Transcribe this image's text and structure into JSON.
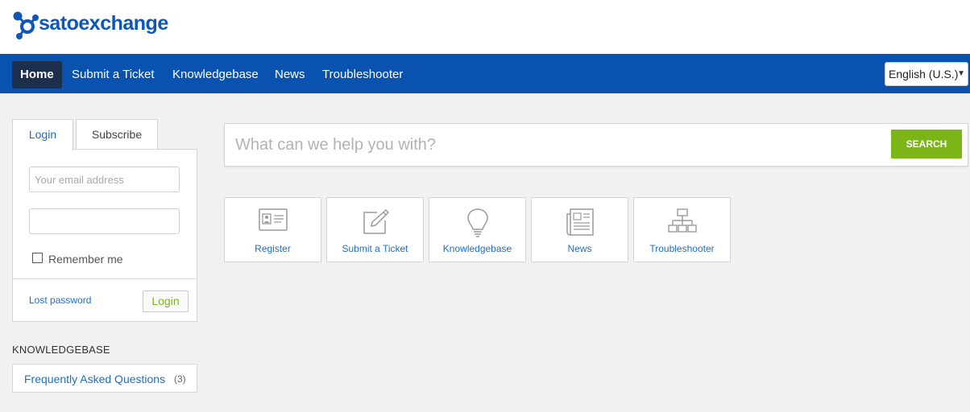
{
  "brand": {
    "logo_text": "satoexchange",
    "color": "#0e57b9"
  },
  "nav": {
    "items": [
      {
        "label": "Home",
        "active": true
      },
      {
        "label": "Submit a Ticket"
      },
      {
        "label": "Knowledgebase"
      },
      {
        "label": "News"
      },
      {
        "label": "Troubleshooter"
      }
    ],
    "language": "English (U.S.)",
    "bar_color": "#0a52b0"
  },
  "sidebar": {
    "tabs": [
      "Login",
      "Subscribe"
    ],
    "email_placeholder": "Your email address",
    "password_value": "",
    "remember_label": "Remember me",
    "lost_password_label": "Lost password",
    "login_button_label": "Login",
    "kb_heading": "KNOWLEDGEBASE",
    "kb_items": [
      {
        "label": "Frequently Asked Questions",
        "count": "(3)"
      }
    ]
  },
  "search": {
    "placeholder": "What can we help you with?",
    "button_label": "SEARCH",
    "button_color": "#7cb518"
  },
  "tiles": [
    {
      "label": "Register",
      "icon": "id-card-icon"
    },
    {
      "label": "Submit a Ticket",
      "icon": "edit-icon"
    },
    {
      "label": "Knowledgebase",
      "icon": "lightbulb-icon"
    },
    {
      "label": "News",
      "icon": "newspaper-icon"
    },
    {
      "label": "Troubleshooter",
      "icon": "sitemap-icon"
    }
  ]
}
